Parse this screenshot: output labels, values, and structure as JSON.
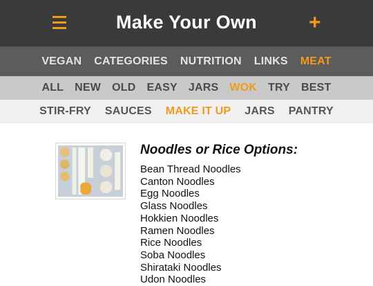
{
  "header": {
    "title": "Make Your Own",
    "menu_icon": "hamburger-menu-icon",
    "add_icon": "plus-icon"
  },
  "colors": {
    "accent": "#f29a1a",
    "topbar": "#3a3a3a",
    "nav1": "#5c5c5c",
    "nav2": "#c9c9c9",
    "nav3": "#f0f0f0"
  },
  "nav_primary": [
    "VEGAN",
    "CATEGORIES",
    "NUTRITION",
    "LINKS",
    "MEAT"
  ],
  "nav_secondary": [
    "ALL",
    "NEW",
    "OLD",
    "EASY",
    "JARS",
    "WOK",
    "TRY",
    "BEST"
  ],
  "nav_tertiary": [
    "STIR-FRY",
    "SAUCES",
    "MAKE IT UP",
    "JARS",
    "PANTRY"
  ],
  "main": {
    "heading": "Noodles or Rice Options:",
    "options": [
      "Bean Thread Noodles",
      "Canton Noodles",
      "Egg Noodles",
      "Glass Noodles",
      "Hokkien Noodles",
      "Ramen Noodles",
      "Rice Noodles",
      "Soba Noodles",
      "Shirataki Noodles",
      "Udon Noodles"
    ]
  }
}
